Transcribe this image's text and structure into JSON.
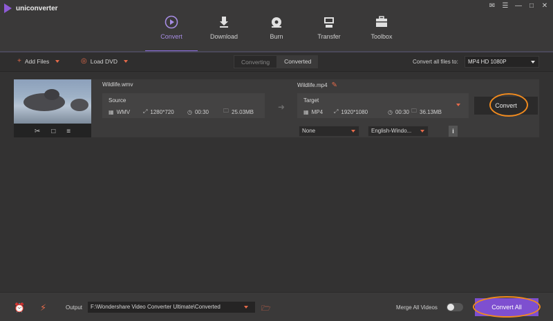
{
  "app": {
    "title": "uniconverter"
  },
  "nav": [
    {
      "label": "Convert",
      "active": true
    },
    {
      "label": "Download"
    },
    {
      "label": "Burn"
    },
    {
      "label": "Transfer"
    },
    {
      "label": "Toolbox"
    }
  ],
  "toolbar": {
    "add_files": "Add Files",
    "load_dvd": "Load DVD",
    "tab_converting": "Converting",
    "tab_converted": "Converted",
    "convert_all_to_label": "Convert all files to:",
    "format_value": "MP4 HD 1080P"
  },
  "file": {
    "source_name": "Wildlife.wmv",
    "target_name": "Wildlife.mp4",
    "source": {
      "title": "Source",
      "format": "WMV",
      "resolution": "1280*720",
      "duration": "00:30",
      "size": "25.03MB"
    },
    "target": {
      "title": "Target",
      "format": "MP4",
      "resolution": "1920*1080",
      "duration": "00:30",
      "size": "36.13MB"
    },
    "subtitle_value": "None",
    "audio_value": "English-Windo...",
    "convert_label": "Convert"
  },
  "footer": {
    "output_label": "Output",
    "output_path": "F:\\Wondershare Video Converter Ultimate\\Converted",
    "merge_label": "Merge All Videos",
    "merge_enabled": false,
    "convert_all_label": "Convert All"
  },
  "colors": {
    "accent": "#7e4fd0",
    "highlight_ring": "#f08a1e",
    "icon_accent": "#e56a4a"
  }
}
